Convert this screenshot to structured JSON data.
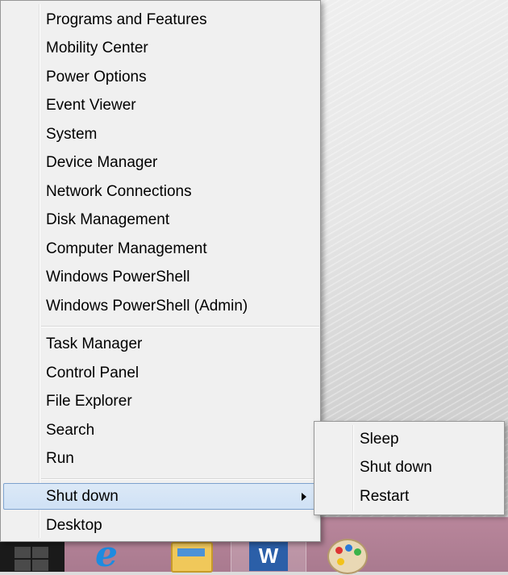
{
  "menu": {
    "group1": [
      {
        "id": "programs-and-features",
        "label": "Programs and Features"
      },
      {
        "id": "mobility-center",
        "label": "Mobility Center"
      },
      {
        "id": "power-options",
        "label": "Power Options"
      },
      {
        "id": "event-viewer",
        "label": "Event Viewer"
      },
      {
        "id": "system",
        "label": "System"
      },
      {
        "id": "device-manager",
        "label": "Device Manager"
      },
      {
        "id": "network-connections",
        "label": "Network Connections"
      },
      {
        "id": "disk-management",
        "label": "Disk Management"
      },
      {
        "id": "computer-management",
        "label": "Computer Management"
      },
      {
        "id": "windows-powershell",
        "label": "Windows PowerShell"
      },
      {
        "id": "windows-powershell-admin",
        "label": "Windows PowerShell (Admin)"
      }
    ],
    "group2": [
      {
        "id": "task-manager",
        "label": "Task Manager"
      },
      {
        "id": "control-panel",
        "label": "Control Panel"
      },
      {
        "id": "file-explorer",
        "label": "File Explorer"
      },
      {
        "id": "search",
        "label": "Search"
      },
      {
        "id": "run",
        "label": "Run"
      }
    ],
    "shutdown": {
      "label": "Shut down",
      "highlighted": true,
      "icon": "chevron-right-icon"
    },
    "desktop": {
      "label": "Desktop"
    }
  },
  "submenu": {
    "items": [
      {
        "id": "sleep",
        "label": "Sleep"
      },
      {
        "id": "shut-down",
        "label": "Shut down"
      },
      {
        "id": "restart",
        "label": "Restart"
      }
    ]
  },
  "taskbar": {
    "start_icon": "windows-logo-icon",
    "apps": [
      {
        "id": "internet-explorer",
        "icon": "internet-explorer-icon"
      },
      {
        "id": "file-explorer",
        "icon": "folder-icon"
      },
      {
        "id": "word",
        "icon": "word-icon",
        "active": true
      },
      {
        "id": "paint",
        "icon": "paint-palette-icon"
      }
    ]
  },
  "colors": {
    "menu_bg": "#f0f0f0",
    "highlight_bg": "#cfe1f5",
    "highlight_border": "#7da2ce",
    "taskbar": "#b9869b"
  }
}
